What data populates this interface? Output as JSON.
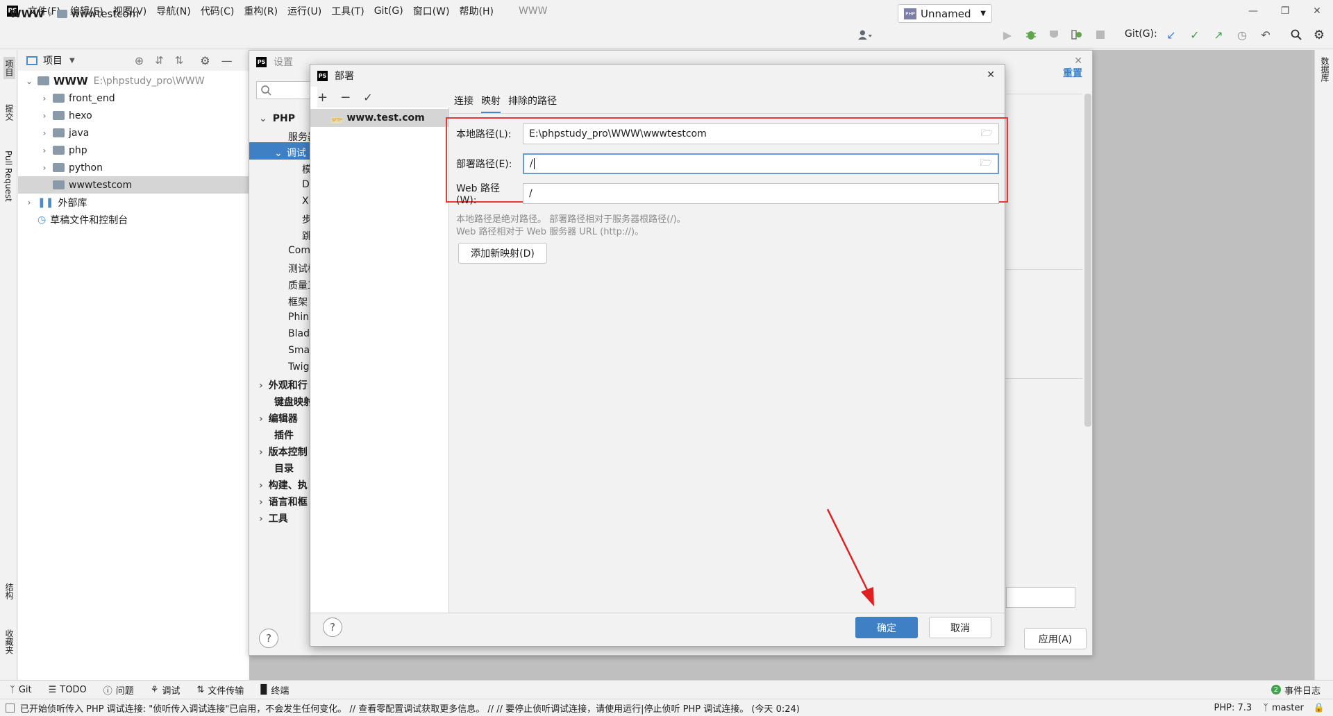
{
  "menubar": {
    "logo": "PS",
    "items": [
      "文件(F)",
      "编辑(E)",
      "视图(V)",
      "导航(N)",
      "代码(C)",
      "重构(R)",
      "运行(U)",
      "工具(T)",
      "Git(G)",
      "窗口(W)",
      "帮助(H)"
    ],
    "app_title": "WWW"
  },
  "navbar": {
    "root": "WWW",
    "folder": "wwwtestcom",
    "run_config": "Unnamed",
    "git_label": "Git(G):"
  },
  "left_strip": {
    "project": "项目",
    "commit": "提交",
    "pull_request": "Pull Request",
    "structure": "结构",
    "favorites": "收藏夹"
  },
  "right_strip": {
    "database": "数据库"
  },
  "project_panel": {
    "header": "项目",
    "root_name": "WWW",
    "root_path": "E:\\phpstudy_pro\\WWW",
    "folders": [
      "front_end",
      "hexo",
      "java",
      "php",
      "python",
      "wwwtestcom"
    ],
    "external_libs": "外部库",
    "scratches": "草稿文件和控制台"
  },
  "settings": {
    "title": "设置",
    "reset": "重置",
    "apply": "应用(A)",
    "tree": [
      "PHP",
      "服务器",
      "调试",
      "模",
      "D",
      "X",
      "步",
      "跳",
      "Com",
      "测试框",
      "质量工",
      "框架",
      "Phin",
      "Blad",
      "Smar",
      "Twig",
      "外观和行",
      "键盘映射",
      "编辑器",
      "插件",
      "版本控制",
      "目录",
      "构建、执",
      "语言和框",
      "工具"
    ]
  },
  "deploy": {
    "title": "部署",
    "server_name": "www.test.com",
    "sftp_badge": "SFTP",
    "tabs": [
      "连接",
      "映射",
      "排除的路径"
    ],
    "local_path_label": "本地路径(L):",
    "local_path_value": "E:\\phpstudy_pro\\WWW\\wwwtestcom",
    "deploy_path_label": "部署路径(E):",
    "deploy_path_value": "/",
    "web_path_label": "Web 路径(W):",
    "web_path_value": "/",
    "hint1": "本地路径是绝对路径。 部署路径相对于服务器根路径(/)。",
    "hint2": "Web 路径相对于 Web 服务器 URL (http://)。",
    "add_mapping": "添加新映射(D)",
    "ok": "确定",
    "cancel": "取消",
    "help": "?"
  },
  "bottom_tools": [
    "Git",
    "TODO",
    "问题",
    "调试",
    "文件传输",
    "终端"
  ],
  "event_log": "事件日志",
  "event_count": "2",
  "status": {
    "message": "已开始侦听传入 PHP 调试连接: \"侦听传入调试连接\"已启用，不会发生任何变化。 // 查看零配置调试获取更多信息。 // // 要停止侦听调试连接，请使用运行|停止侦听 PHP 调试连接。 (今天 0:24)",
    "php_version": "PHP: 7.3",
    "branch": "master"
  },
  "colors": {
    "accent": "#3f7fc4",
    "highlight_box": "#e53935",
    "arrow": "#e02020",
    "selection": "#d5d5d5"
  }
}
